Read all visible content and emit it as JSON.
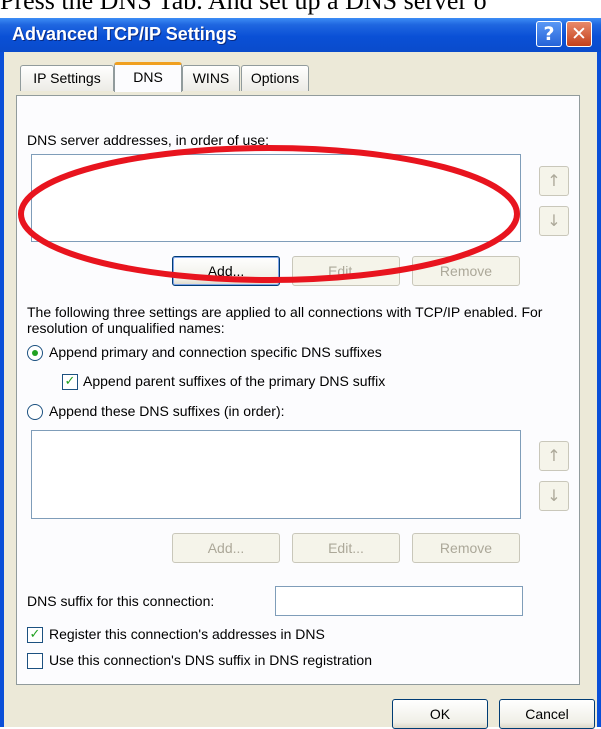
{
  "caption": "Press the DNS Tab. And set up a DNS server o",
  "window": {
    "title": "Advanced TCP/IP Settings",
    "help_glyph": "?",
    "close_glyph": "✕"
  },
  "tabs": [
    {
      "label": "IP Settings"
    },
    {
      "label": "DNS"
    },
    {
      "label": "WINS"
    },
    {
      "label": "Options"
    }
  ],
  "dns_servers": {
    "label": "DNS server addresses, in order of use:",
    "items": [],
    "add_label": "Add...",
    "edit_label": "Edit...",
    "remove_label": "Remove",
    "up_glyph": "↑",
    "down_glyph": "↓"
  },
  "resolution_note": "The following three settings are applied to all connections with TCP/IP enabled. For resolution of unqualified names:",
  "options": {
    "append_primary_label": "Append primary and connection specific DNS suffixes",
    "append_primary_selected": true,
    "append_parent_label": "Append parent suffixes of the primary DNS suffix",
    "append_parent_checked": true,
    "append_these_label": "Append these DNS suffixes (in order):",
    "append_these_selected": false
  },
  "suffixes": {
    "items": [],
    "add_label": "Add...",
    "edit_label": "Edit...",
    "remove_label": "Remove",
    "up_glyph": "↑",
    "down_glyph": "↓"
  },
  "connection_suffix": {
    "label": "DNS suffix for this connection:",
    "value": ""
  },
  "register": {
    "label": "Register this connection's addresses in DNS",
    "checked": true,
    "checkmark": "✓"
  },
  "use_suffix": {
    "label": "Use this connection's DNS suffix in DNS registration",
    "checked": false
  },
  "footer": {
    "ok_label": "OK",
    "cancel_label": "Cancel"
  },
  "colors": {
    "titlebar": "#0a50d6",
    "dialog_face": "#ece9d8",
    "highlight_ellipse": "#e8141e"
  }
}
